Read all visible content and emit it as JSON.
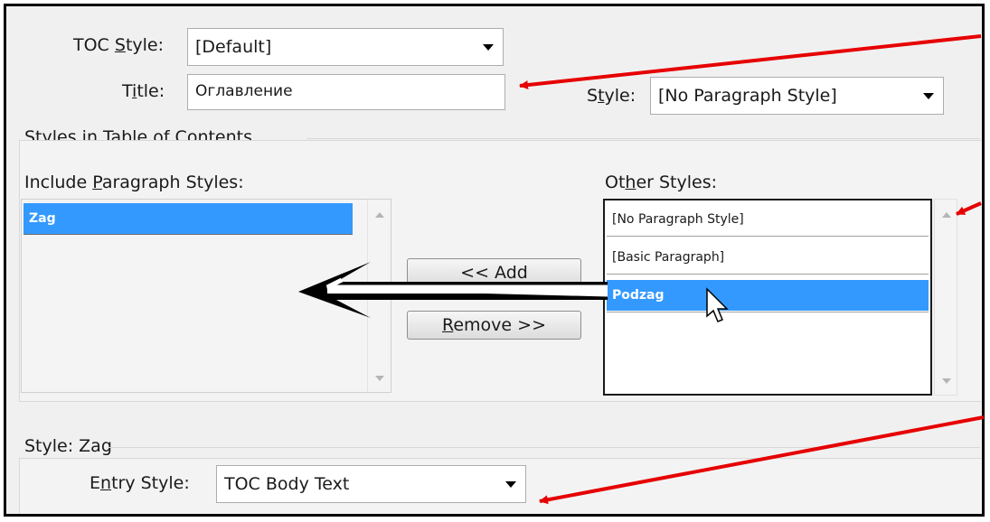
{
  "toc_style": {
    "label_pre": "TOC ",
    "label_u": "S",
    "label_post": "tyle:",
    "value": "[Default]"
  },
  "title": {
    "label_pre": "T",
    "label_u": "i",
    "label_post": "tle:",
    "value": "Оглавление"
  },
  "title_style": {
    "label_pre": "S",
    "label_u": "t",
    "label_post": "yle:",
    "value": "[No Paragraph Style]"
  },
  "styles_group": {
    "label": "Styles in Table of Contents"
  },
  "include": {
    "label_pre": "Include ",
    "label_u": "P",
    "label_post": "aragraph Styles:",
    "items": [
      "Zag"
    ]
  },
  "other": {
    "label_pre": "Ot",
    "label_u": "h",
    "label_post": "er Styles:",
    "items": [
      "[No Paragraph Style]",
      "[Basic Paragraph]",
      "Podzag"
    ]
  },
  "buttons": {
    "add": "<< Add",
    "remove_u": "R",
    "remove_rest": "emove >>"
  },
  "style_group": {
    "label": "Style: Zag"
  },
  "entry_style": {
    "label_pre": "E",
    "label_u": "n",
    "label_post": "try Style:",
    "value": "TOC Body Text"
  },
  "colors": {
    "selection": "#3399ff",
    "annotation_arrow": "#e60000"
  }
}
